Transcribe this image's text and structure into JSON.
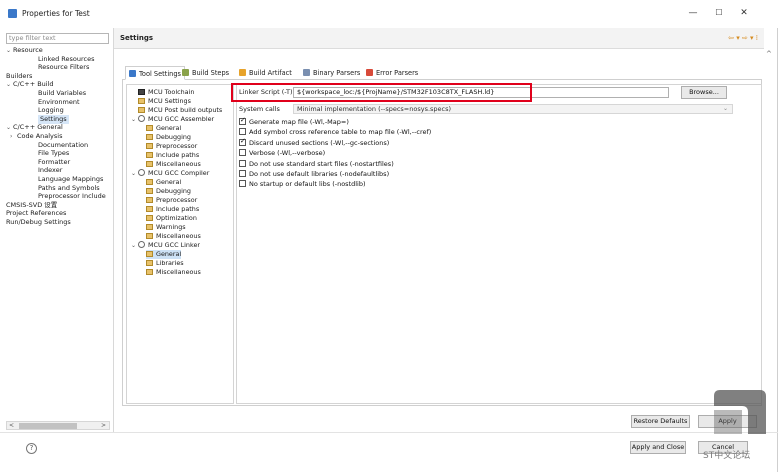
{
  "window": {
    "title": "Properties for Test",
    "controls": [
      "—",
      "☐",
      "✕"
    ]
  },
  "left": {
    "filter_placeholder": "type filter text",
    "tree": [
      {
        "label": "Resource",
        "expanded": true,
        "indent": 0,
        "name": "resource"
      },
      {
        "label": "Linked Resources",
        "indent": 2,
        "name": "linked-resources"
      },
      {
        "label": "Resource Filters",
        "indent": 2,
        "name": "resource-filters"
      },
      {
        "label": "Builders",
        "indent": 0,
        "name": "builders"
      },
      {
        "label": "C/C++ Build",
        "expanded": true,
        "indent": 0,
        "name": "cpp-build"
      },
      {
        "label": "Build Variables",
        "indent": 2,
        "name": "build-variables"
      },
      {
        "label": "Environment",
        "indent": 2,
        "name": "environment"
      },
      {
        "label": "Logging",
        "indent": 2,
        "name": "logging"
      },
      {
        "label": "Settings",
        "indent": 2,
        "selected": true,
        "name": "settings"
      },
      {
        "label": "C/C++ General",
        "expanded": true,
        "indent": 0,
        "name": "cpp-general"
      },
      {
        "label": "Code Analysis",
        "collapsed": true,
        "indent": 1,
        "name": "code-analysis"
      },
      {
        "label": "Documentation",
        "indent": 2,
        "name": "documentation"
      },
      {
        "label": "File Types",
        "indent": 2,
        "name": "file-types"
      },
      {
        "label": "Formatter",
        "indent": 2,
        "name": "formatter"
      },
      {
        "label": "Indexer",
        "indent": 2,
        "name": "indexer"
      },
      {
        "label": "Language Mappings",
        "indent": 2,
        "name": "language-mappings"
      },
      {
        "label": "Paths and Symbols",
        "indent": 2,
        "name": "paths-and-symbols"
      },
      {
        "label": "Preprocessor Include",
        "indent": 2,
        "name": "preprocessor-include"
      },
      {
        "label": "CMSIS-SVD 设置",
        "indent": 0,
        "name": "cmsis-svd"
      },
      {
        "label": "Project References",
        "indent": 0,
        "name": "project-references"
      },
      {
        "label": "Run/Debug Settings",
        "indent": 0,
        "name": "run-debug-settings"
      }
    ]
  },
  "header": {
    "title": "Settings",
    "nav": "⇦ ▾ ⇨ ▾ ⁞"
  },
  "tabs": [
    {
      "label": "Tool Settings",
      "active": true,
      "color": "#3a78c9"
    },
    {
      "label": "Build Steps",
      "color": "#8aa24a"
    },
    {
      "label": "Build Artifact",
      "color": "#e7a32b"
    },
    {
      "label": "Binary Parsers",
      "color": "#7a8fb0"
    },
    {
      "label": "Error Parsers",
      "color": "#d84a3a"
    }
  ],
  "subtree": [
    {
      "label": "MCU Toolchain",
      "icon": "tool",
      "indent": 0
    },
    {
      "label": "MCU Settings",
      "icon": "folder",
      "indent": 0
    },
    {
      "label": "MCU Post build outputs",
      "icon": "folder",
      "indent": 0
    },
    {
      "label": "MCU GCC Assembler",
      "icon": "gear",
      "indent": 0,
      "expanded": true
    },
    {
      "label": "General",
      "icon": "folder",
      "indent": 1
    },
    {
      "label": "Debugging",
      "icon": "folder",
      "indent": 1
    },
    {
      "label": "Preprocessor",
      "icon": "folder",
      "indent": 1
    },
    {
      "label": "Include paths",
      "icon": "folder",
      "indent": 1
    },
    {
      "label": "Miscellaneous",
      "icon": "folder",
      "indent": 1
    },
    {
      "label": "MCU GCC Compiler",
      "icon": "gear",
      "indent": 0,
      "expanded": true
    },
    {
      "label": "General",
      "icon": "folder",
      "indent": 1
    },
    {
      "label": "Debugging",
      "icon": "folder",
      "indent": 1
    },
    {
      "label": "Preprocessor",
      "icon": "folder",
      "indent": 1
    },
    {
      "label": "Include paths",
      "icon": "folder",
      "indent": 1
    },
    {
      "label": "Optimization",
      "icon": "folder",
      "indent": 1
    },
    {
      "label": "Warnings",
      "icon": "folder",
      "indent": 1
    },
    {
      "label": "Miscellaneous",
      "icon": "folder",
      "indent": 1
    },
    {
      "label": "MCU GCC Linker",
      "icon": "gear",
      "indent": 0,
      "expanded": true
    },
    {
      "label": "General",
      "icon": "folder",
      "indent": 1,
      "selected": true
    },
    {
      "label": "Libraries",
      "icon": "folder",
      "indent": 1
    },
    {
      "label": "Miscellaneous",
      "icon": "folder",
      "indent": 1
    }
  ],
  "form": {
    "linker_label": "Linker Script (-T)",
    "linker_value": "${workspace_loc:/${ProjName}/STM32F103C8TX_FLASH.ld}",
    "browse_label": "Browse...",
    "system_calls_label": "System calls",
    "system_calls_value": "Minimal implementation (--specs=nosys.specs)",
    "checks": [
      {
        "label": "Generate map file (-Wl,-Map=)",
        "checked": true
      },
      {
        "label": "Add symbol cross reference table to map file (-Wl,--cref)",
        "checked": false
      },
      {
        "label": "Discard unused sections (-Wl,--gc-sections)",
        "checked": true
      },
      {
        "label": "Verbose (-Wl,--verbose)",
        "checked": false
      },
      {
        "label": "Do not use standard start files (-nostartfiles)",
        "checked": false
      },
      {
        "label": "Do not use default libraries (-nodefaultlibs)",
        "checked": false
      },
      {
        "label": "No startup or default libs (-nostdlib)",
        "checked": false
      }
    ]
  },
  "buttons": {
    "restore_defaults": "Restore Defaults",
    "apply": "Apply",
    "apply_and_close": "Apply and Close",
    "cancel": "Cancel"
  },
  "watermark": "ST中文论坛",
  "colors": {
    "highlight_box": "#e0001b",
    "selection": "#cde2f6"
  }
}
